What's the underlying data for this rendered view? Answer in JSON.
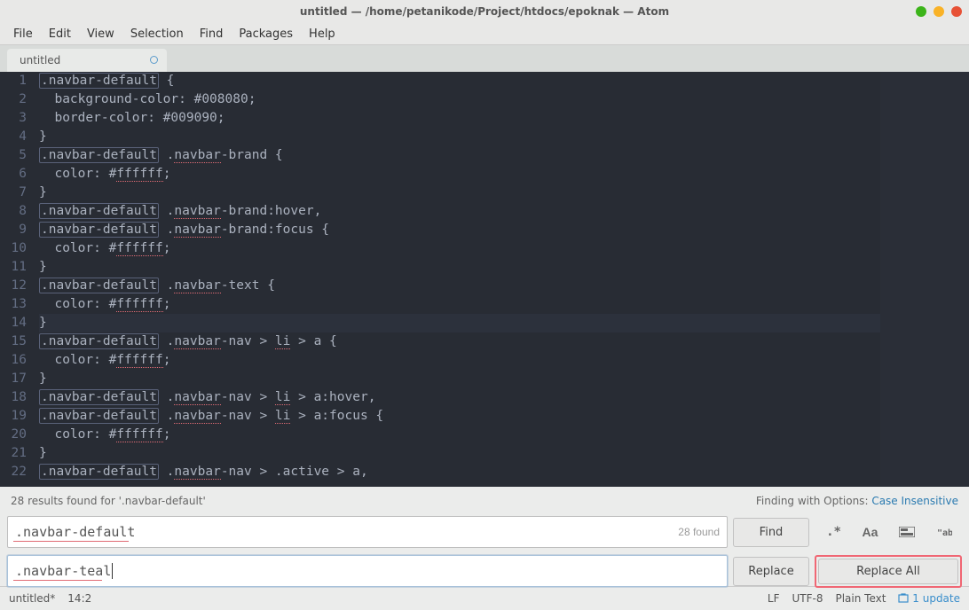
{
  "window": {
    "title": "untitled — /home/petanikode/Project/htdocs/epoknak — Atom"
  },
  "menu": [
    "File",
    "Edit",
    "View",
    "Selection",
    "Find",
    "Packages",
    "Help"
  ],
  "tab": {
    "label": "untitled"
  },
  "lines": [
    ".navbar-default {",
    "  background-color: #008080;",
    "  border-color: #009090;",
    "}",
    ".navbar-default .navbar-brand {",
    "  color: #ffffff;",
    "}",
    ".navbar-default .navbar-brand:hover,",
    ".navbar-default .navbar-brand:focus {",
    "  color: #ffffff;",
    "}",
    ".navbar-default .navbar-text {",
    "  color: #ffffff;",
    "}",
    ".navbar-default .navbar-nav > li > a {",
    "  color: #ffffff;",
    "}",
    ".navbar-default .navbar-nav > li > a:hover,",
    ".navbar-default .navbar-nav > li > a:focus {",
    "  color: #ffffff;",
    "}",
    ".navbar-default .navbar-nav > .active > a,"
  ],
  "find": {
    "status_left": "28 results found for '.navbar-default'",
    "status_right_prefix": "Finding with Options:",
    "status_right_option": "Case Insensitive",
    "search_value": ".navbar-default",
    "search_count": "28 found",
    "replace_value": ".navbar-teal",
    "btn_find": "Find",
    "btn_replace": "Replace",
    "btn_replace_all": "Replace All",
    "opts": {
      "regex": ".*",
      "case": "Aa",
      "selection_icon": "selection-icon",
      "whole_word_icon": "whole-word-icon"
    }
  },
  "footer": {
    "file": "untitled*",
    "pos": "14:2",
    "eol": "LF",
    "enc": "UTF-8",
    "grammar": "Plain Text",
    "update": "1 update"
  }
}
